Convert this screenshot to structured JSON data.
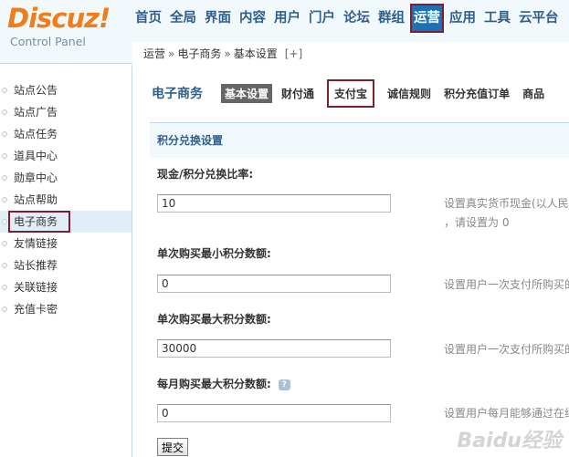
{
  "logo": {
    "brand_prefix": "Discuz",
    "brand_bang": "!",
    "subtitle": "Control Panel"
  },
  "topnav": {
    "items": [
      {
        "label": "首页"
      },
      {
        "label": "全局"
      },
      {
        "label": "界面"
      },
      {
        "label": "内容"
      },
      {
        "label": "用户"
      },
      {
        "label": "门户"
      },
      {
        "label": "论坛"
      },
      {
        "label": "群组"
      },
      {
        "label": "运营",
        "active": true
      },
      {
        "label": "应用"
      },
      {
        "label": "工具"
      },
      {
        "label": "云平台"
      }
    ]
  },
  "breadcrumb": {
    "items": [
      "运营",
      "电子商务",
      "基本设置"
    ],
    "sep": "»",
    "plus": "[+]"
  },
  "sidebar": {
    "items": [
      {
        "label": "站点公告"
      },
      {
        "label": "站点广告"
      },
      {
        "label": "站点任务"
      },
      {
        "label": "道具中心"
      },
      {
        "label": "勋章中心"
      },
      {
        "label": "站点帮助"
      },
      {
        "label": "电子商务",
        "active": true
      },
      {
        "label": "友情链接"
      },
      {
        "label": "站长推荐"
      },
      {
        "label": "关联链接"
      },
      {
        "label": "充值卡密"
      }
    ]
  },
  "subnav": {
    "section_title": "电子商务",
    "tabs": [
      {
        "label": "基本设置",
        "current": true
      },
      {
        "label": "财付通"
      },
      {
        "label": "支付宝",
        "highlighted": true
      },
      {
        "label": "诚信规则"
      },
      {
        "label": "积分充值订单"
      },
      {
        "label": "商品"
      }
    ]
  },
  "panel": {
    "title": "积分兑换设置"
  },
  "fields": {
    "ratio": {
      "label": "现金/积分兑换比率:",
      "value": "10",
      "tip_line1": "设置真实货币现金(以人民",
      "tip_line2": "，请设置为 0"
    },
    "min": {
      "label": "单次购买最小积分数额:",
      "value": "0",
      "tip_line1": "设置用户一次支付所购买的"
    },
    "max": {
      "label": "单次购买最大积分数额:",
      "value": "30000",
      "tip_line1": "设置用户一次支付所购买的"
    },
    "monthly": {
      "label": "每月购买最大积分数额:",
      "value": "0",
      "tip_line1": "设置用户每月能够通过在线"
    }
  },
  "help_icon": "?",
  "submit_label": "提交",
  "watermark": "Baidu经验"
}
